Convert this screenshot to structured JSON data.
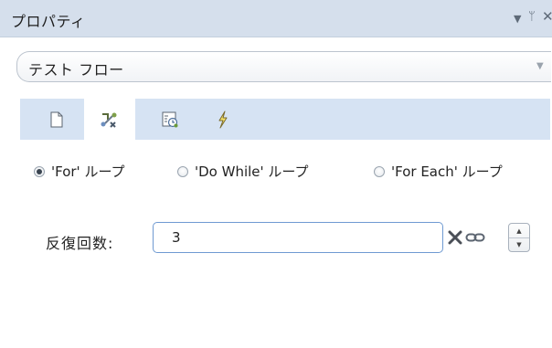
{
  "panel": {
    "title": "プロパティ"
  },
  "window_controls": {
    "menu": "▼",
    "pin": "ᛘ",
    "close": "✕"
  },
  "flow_select": {
    "value": "テスト フロー"
  },
  "tabs": [
    {
      "icon": "document-icon",
      "active": false
    },
    {
      "icon": "loop-arrows-icon",
      "active": true
    },
    {
      "icon": "schedule-icon",
      "active": false
    },
    {
      "icon": "lightning-icon",
      "active": false
    }
  ],
  "loop_options": [
    {
      "label": "'For' ループ",
      "checked": true
    },
    {
      "label": "'Do While' ループ",
      "checked": false
    },
    {
      "label": "'For Each' ループ",
      "checked": false
    }
  ],
  "iterations": {
    "label": "反復回数:",
    "value": "3"
  },
  "colors": {
    "title_bar": "#d5dfec",
    "tab_strip": "#d6e3f3",
    "input_border": "#6f9ad2",
    "clear_icon": "#4a4f57"
  }
}
